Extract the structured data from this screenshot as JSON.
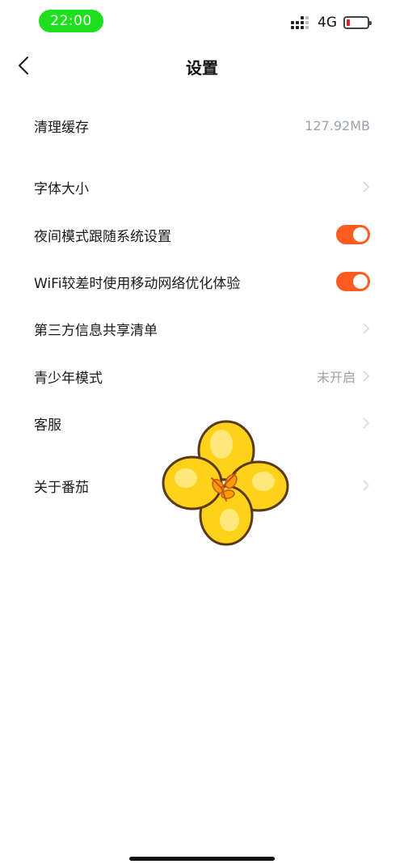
{
  "status_bar": {
    "time": "22:00",
    "network": "4G"
  },
  "nav": {
    "title": "设置"
  },
  "settings": [
    {
      "label": "清理缓存",
      "value": "127.92MB"
    },
    {
      "label": "字体大小"
    },
    {
      "label": "夜间模式跟随系统设置",
      "toggle": true
    },
    {
      "label": "WiFi较差时使用移动网络优化体验",
      "toggle": true
    },
    {
      "label": "第三方信息共享清单"
    },
    {
      "label": "青少年模式",
      "value": "未开启"
    },
    {
      "label": "客服"
    },
    {
      "label": "关于番茄"
    }
  ],
  "colors": {
    "accent": "#ff5a1f",
    "time_pill": "#1fe01f",
    "value_text": "#9aa3ad"
  },
  "icons": {
    "back": "chevron-left-icon",
    "row_chevron": "chevron-right-icon"
  }
}
